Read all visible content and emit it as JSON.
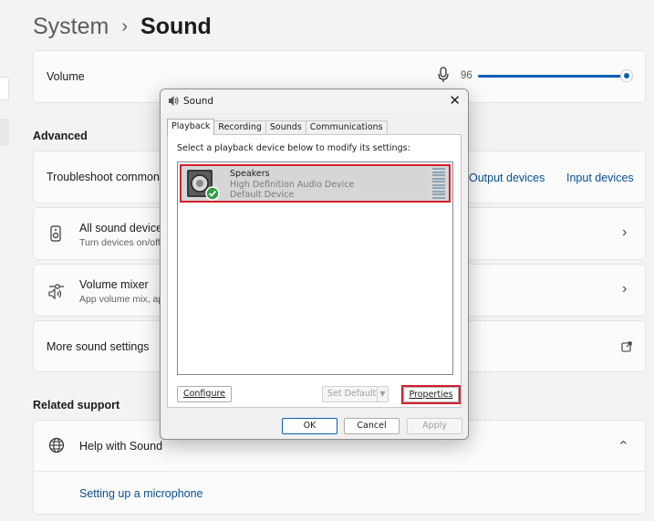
{
  "breadcrumb": {
    "parent": "System",
    "separator": "›",
    "current": "Sound"
  },
  "volume": {
    "label": "Volume",
    "value_text": "96",
    "level": 0.96
  },
  "advanced": {
    "title": "Advanced",
    "troubleshoot_label": "Troubleshoot common s",
    "output_devices": "Output devices",
    "input_devices": "Input devices",
    "all_devices_title": "All sound devices",
    "all_devices_sub": "Turn devices on/off",
    "mixer_title": "Volume mixer",
    "mixer_sub": "App volume mix, ap",
    "more_settings": "More sound settings"
  },
  "related": {
    "title": "Related support",
    "help_label": "Help with Sound",
    "microphone_link": "Setting up a microphone"
  },
  "dialog": {
    "title": "Sound",
    "tabs": [
      "Playback",
      "Recording",
      "Sounds",
      "Communications"
    ],
    "instruction": "Select a playback device below to modify its settings:",
    "device": {
      "name": "Speakers",
      "description": "High Definition Audio Device",
      "status": "Default Device"
    },
    "buttons": {
      "configure": "Configure",
      "set_default": "Set Default",
      "properties": "Properties",
      "ok": "OK",
      "cancel": "Cancel",
      "apply": "Apply"
    }
  },
  "colors": {
    "accent": "#0a5fb4",
    "highlight": "#d2202e",
    "link": "#0a4f8f"
  },
  "icons": [
    "chevron-right-icon",
    "microphone-icon",
    "speaker-device-icon",
    "volume-mixer-icon",
    "globe-help-icon",
    "open-external-icon",
    "chevron-up-icon",
    "sound-icon",
    "close-icon",
    "checkmark-badge-icon"
  ]
}
